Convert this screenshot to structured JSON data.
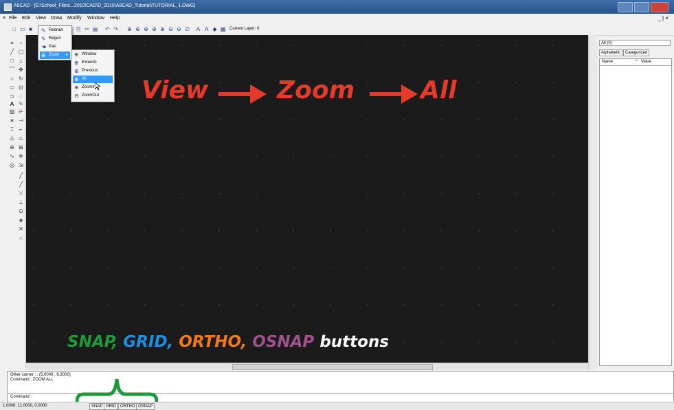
{
  "window": {
    "title": "A9CAD - [E:\\School_Files\\...2010\\CAD\\D_2010\\A9CAD_Tutorial\\TUTORIAL_1.DWG]"
  },
  "menubar": {
    "items": [
      "File",
      "Edit",
      "View",
      "Draw",
      "Modify",
      "Window",
      "Help"
    ],
    "mdi_buttons": "_ | ×"
  },
  "toolbar": {
    "current_layer": "Current Layer: 0"
  },
  "view_menu": {
    "items": [
      {
        "label": "Redraw",
        "icon": "redraw-icon"
      },
      {
        "label": "Regen",
        "icon": "regen-icon"
      },
      {
        "label": "Pan",
        "icon": "pan-icon"
      },
      {
        "label": "Zoom",
        "icon": "zoom-icon",
        "highlighted": true,
        "submenu_arrow": "▸"
      }
    ]
  },
  "zoom_submenu": {
    "items": [
      {
        "label": "Window",
        "icon": "zoom-window-icon"
      },
      {
        "label": "Extends",
        "icon": "zoom-extends-icon"
      },
      {
        "label": "Previous",
        "icon": "zoom-previous-icon"
      },
      {
        "label": "All",
        "icon": "zoom-all-icon",
        "highlighted": true
      },
      {
        "label": "ZoomIn",
        "icon": "zoom-in-icon"
      },
      {
        "label": "ZoomOut",
        "icon": "zoom-out-icon"
      }
    ]
  },
  "annotation": {
    "view": "View",
    "zoom": "Zoom",
    "all": "All",
    "arrow_color": "#e43a2a",
    "buttons_caption": {
      "snap": "SNAP,",
      "grid": "GRID,",
      "ortho": "ORTHO,",
      "osnap": "OSNAP",
      "buttons": "buttons"
    },
    "colors": {
      "snap": "#1f9a3a",
      "grid": "#1e8fe0",
      "ortho": "#f07a1a",
      "osnap": "#a0508a",
      "buttons": "#ffffff",
      "brace": "#1f9a3a"
    }
  },
  "properties_panel": {
    "selector": "All (0)",
    "tabs": [
      "Alphabetic",
      "Categorized"
    ],
    "columns": [
      "Name",
      "Value"
    ]
  },
  "command": {
    "history": [
      "Other corner : : (5.0000 , 6.3000)",
      "Command : ZOOM ALL"
    ],
    "prompt": "Command :"
  },
  "statusbar": {
    "coords": "1.0000, 11.0000, 0.0000",
    "buttons": [
      "SNAP",
      "GRID",
      "ORTHO",
      "OSNAP"
    ]
  }
}
